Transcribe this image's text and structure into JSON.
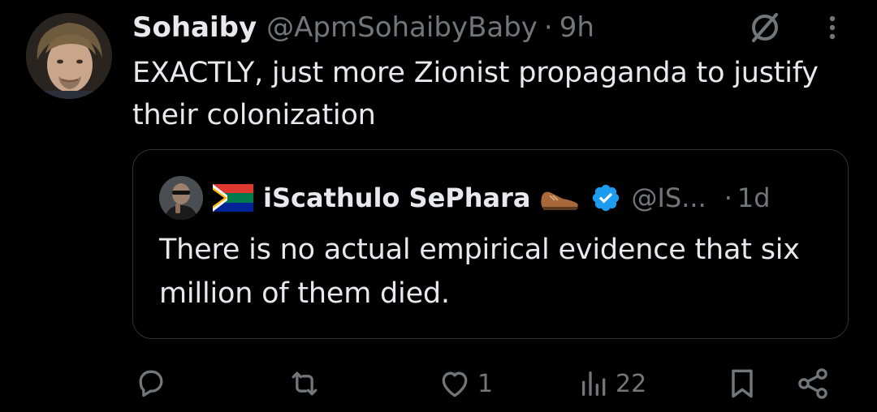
{
  "tweet": {
    "author_name": "Sohaiby",
    "author_handle": "@ApmSohaibyBaby",
    "separator": "·",
    "time": "9h",
    "text": "EXACTLY, just more Zionist propaganda to justify their colonization",
    "avatar_icon": "user-avatar",
    "grok_icon": "grok-icon",
    "more_icon": "more-options-icon"
  },
  "quote": {
    "author_name": "iScathulo SePhara",
    "flag_icon": "south-africa-flag-icon",
    "shoe_icon": "shoe-emoji-icon",
    "verified_icon": "verified-badge-icon",
    "author_handle": "@IS...",
    "separator": "·",
    "time": "1d",
    "text": "There is no actual empirical evidence that six million of them died."
  },
  "actions": {
    "reply_count": "",
    "retweet_count": "",
    "like_count": "1",
    "views_count": "22",
    "bookmark_label": "",
    "share_label": ""
  },
  "colors": {
    "background": "#000000",
    "primary_text": "#e7e9ea",
    "secondary_text": "#71767b",
    "border": "#2f3336",
    "verified_blue": "#1d9bf0"
  }
}
